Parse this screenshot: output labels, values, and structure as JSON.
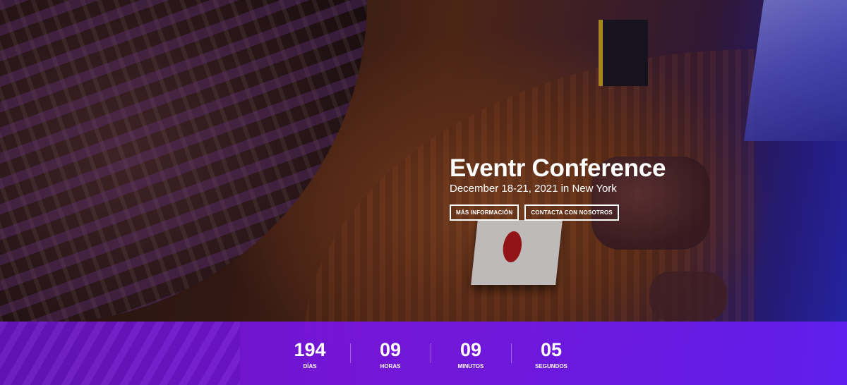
{
  "hero": {
    "title": "Eventr Conference",
    "subtitle": "December 18-21, 2021 in New York",
    "buttons": {
      "more_info": "MÁS INFORMACIÓN",
      "contact": "CONTACTA CON NOSOTROS"
    }
  },
  "countdown": {
    "units": [
      {
        "value": "194",
        "label": "DÍAS"
      },
      {
        "value": "09",
        "label": "HORAS"
      },
      {
        "value": "09",
        "label": "MINUTOS"
      },
      {
        "value": "05",
        "label": "SEGUNDOS"
      }
    ]
  },
  "colors": {
    "countdown_bar": "#7a18e0",
    "text": "#ffffff"
  }
}
